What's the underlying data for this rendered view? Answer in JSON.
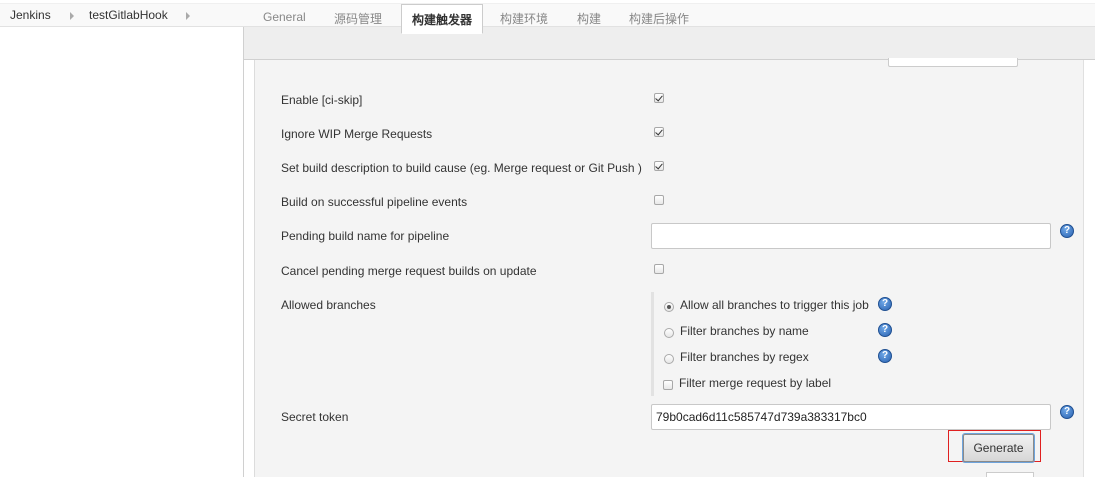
{
  "breadcrumb": {
    "items": [
      "Jenkins",
      "testGitlabHook"
    ]
  },
  "tabs": [
    {
      "label": "General",
      "active": false
    },
    {
      "label": "源码管理",
      "active": false
    },
    {
      "label": "构建触发器",
      "active": true
    },
    {
      "label": "构建环境",
      "active": false
    },
    {
      "label": "构建",
      "active": false
    },
    {
      "label": "构建后操作",
      "active": false
    }
  ],
  "settings": {
    "ci_skip": {
      "label": "Enable [ci-skip]",
      "checked": true
    },
    "ignore_wip": {
      "label": "Ignore WIP Merge Requests",
      "checked": true
    },
    "set_build_description": {
      "label": "Set build description to build cause (eg. Merge request or Git Push )",
      "checked": true
    },
    "build_on_pipeline": {
      "label": "Build on successful pipeline events",
      "checked": false
    },
    "pending_build_name": {
      "label": "Pending build name for pipeline",
      "value": ""
    },
    "cancel_pending": {
      "label": "Cancel pending merge request builds on update",
      "checked": false
    },
    "allowed_branches": {
      "label": "Allowed branches",
      "options": [
        {
          "label": "Allow all branches to trigger this job",
          "selected": true
        },
        {
          "label": "Filter branches by name",
          "selected": false
        },
        {
          "label": "Filter branches by regex",
          "selected": false
        }
      ],
      "filter_by_label": {
        "label": "Filter merge request by label",
        "checked": false
      }
    },
    "secret_token": {
      "label": "Secret token",
      "value": "79b0cad6d11c585747d739a383317bc0"
    },
    "generate_button": "Generate"
  },
  "colors": {
    "highlight": "#e02020",
    "help_icon": "#2a62b0"
  },
  "icons": {
    "help": "question-mark-circle",
    "breadcrumb_separator": "triangle-right"
  }
}
